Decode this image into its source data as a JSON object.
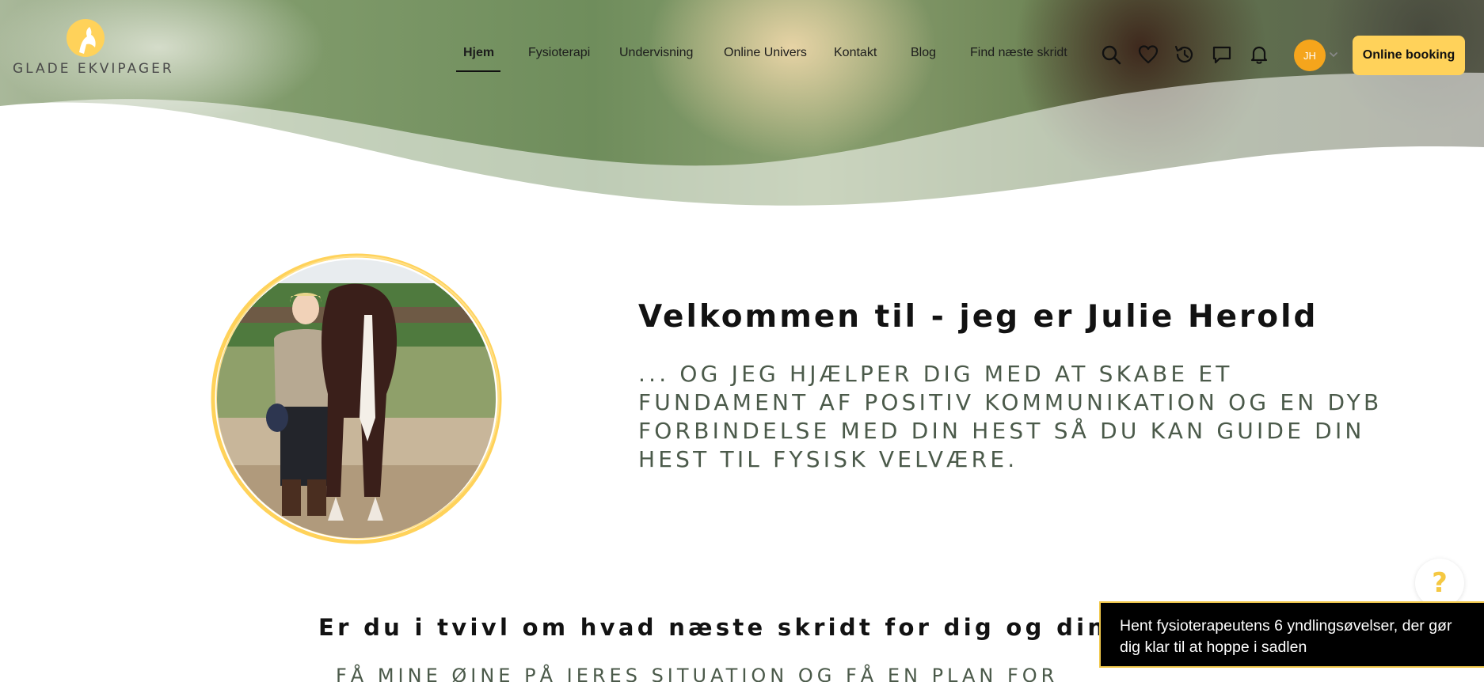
{
  "brand": {
    "name": "GLADE EKVIPAGER",
    "logo_icon": "sun-horse-icon",
    "accent": "#ffd25a"
  },
  "nav": {
    "items": [
      {
        "label": "Hjem",
        "active": true
      },
      {
        "label": "Fysioterapi",
        "active": false
      },
      {
        "label": "Undervisning",
        "active": false
      },
      {
        "label": "Online Univers",
        "active": false
      },
      {
        "label": "Kontakt",
        "active": false
      },
      {
        "label": "Blog",
        "active": false
      },
      {
        "label": "Find næste skridt",
        "active": false
      }
    ]
  },
  "header_icons": [
    "search-icon",
    "heart-icon",
    "history-icon",
    "chat-icon",
    "bell-icon"
  ],
  "user": {
    "initials": "JH",
    "avatar_color": "#f5a51c"
  },
  "booking_button": {
    "label": "Online booking",
    "color": "#ffd25a"
  },
  "intro": {
    "title": "Velkommen til - jeg er Julie Herold",
    "subtitle": "... og jeg hjælper dig med at skabe et fundament af positiv kommunikation og en dyb forbindelse med din hest så du kan guide din hest til fysisk velvære.",
    "portrait_ring_color": "#ffd25a"
  },
  "section2": {
    "title": "Er du i tvivl om hvad næste skridt for dig og din hest",
    "subtitle": "FÅ MINE ØJNE PÅ JERES SITUATION OG FÅ EN PLAN FOR"
  },
  "help_button": {
    "label": "?",
    "color": "#f5c842"
  },
  "popup": {
    "text": "Hent fysioterapeutens 6 yndlingsøvelser, der gør dig klar til at hoppe i sadlen"
  }
}
